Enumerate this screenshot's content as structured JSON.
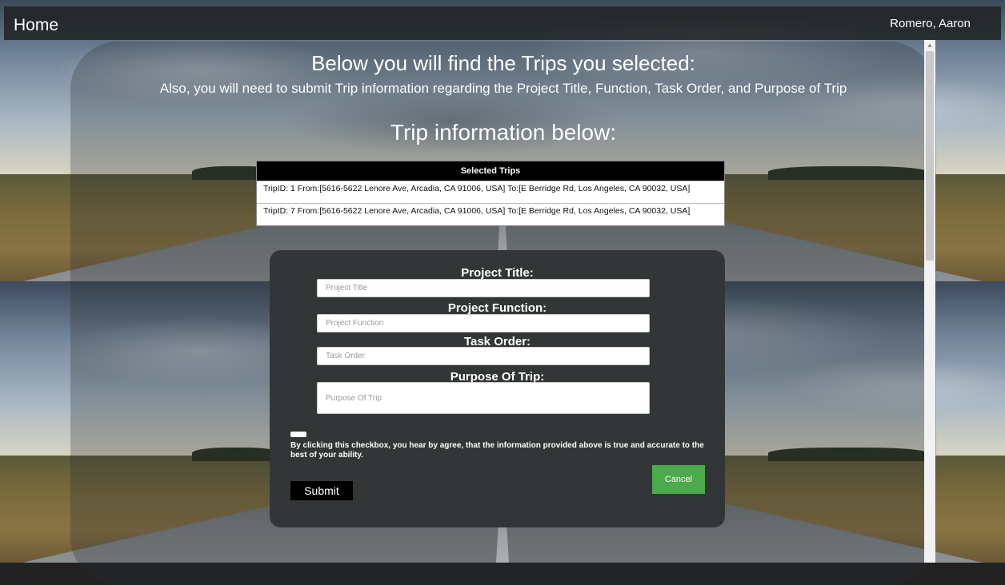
{
  "header": {
    "home_label": "Home",
    "user_name": "Romero, Aaron"
  },
  "main": {
    "heading": "Below you will find the Trips you selected:",
    "subheading": "Also, you will need to submit Trip information regarding the Project Title, Function, Task Order, and Purpose of Trip",
    "trip_heading": "Trip information below:"
  },
  "trips": {
    "header": "Selected Trips",
    "rows": [
      "TripID: 1 From:[5616-5622 Lenore Ave, Arcadia, CA 91006, USA] To:[E Berridge Rd, Los Angeles, CA 90032, USA]",
      "TripID: 7 From:[5616-5622 Lenore Ave, Arcadia, CA 91006, USA] To:[E Berridge Rd, Los Angeles, CA 90032, USA]"
    ]
  },
  "form": {
    "project_title_label": "Project Title:",
    "project_title_placeholder": "Project Title",
    "project_function_label": "Project Function:",
    "project_function_placeholder": "Project Function",
    "task_order_label": "Task Order:",
    "task_order_placeholder": "Task Order",
    "purpose_label": "Purpose Of Trip:",
    "purpose_placeholder": "Purpose Of Trip",
    "agreement_text": "By clicking this checkbox, you hear by agree, that the information provided above is true and accurate to the best of your ability.",
    "submit_label": "Submit",
    "cancel_label": "Cancel"
  },
  "colors": {
    "card_bg": "#333637",
    "cancel_button": "#4caa4c",
    "submit_button": "#000000"
  }
}
